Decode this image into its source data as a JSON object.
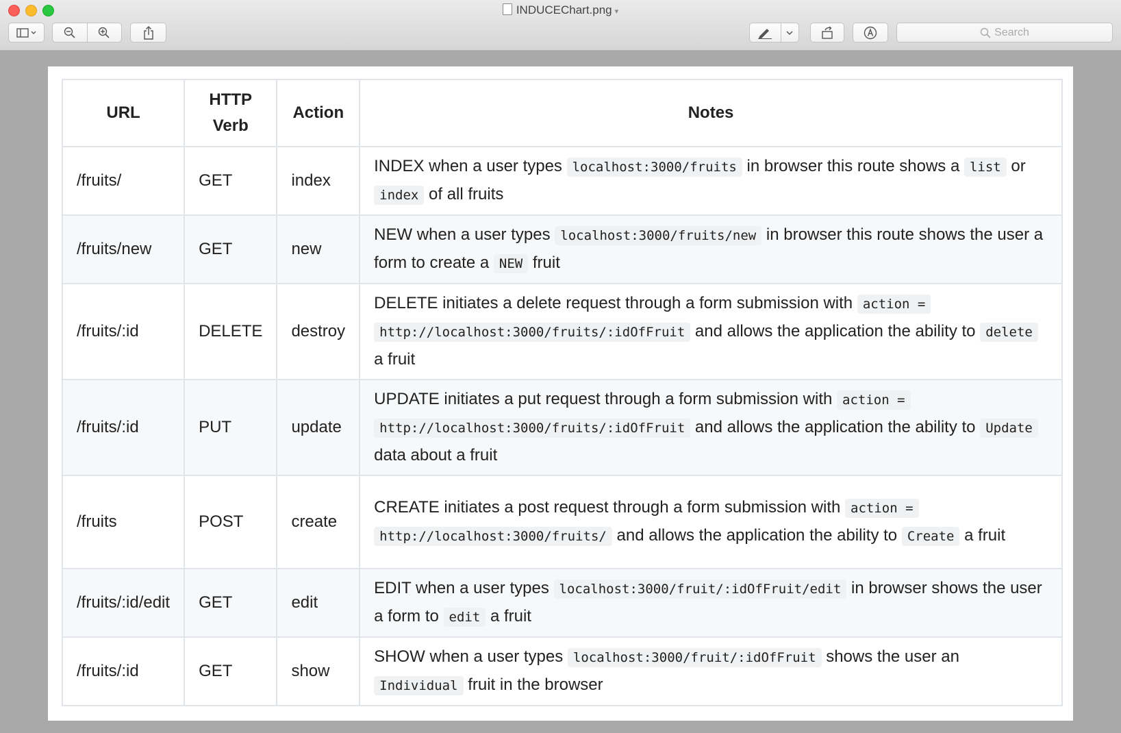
{
  "window": {
    "title": "INDUCEChart.png"
  },
  "toolbar": {
    "search_placeholder": "Search"
  },
  "table": {
    "headers": {
      "url": "URL",
      "verb_line1": "HTTP",
      "verb_line2": "Verb",
      "action": "Action",
      "notes": "Notes"
    },
    "rows": [
      {
        "url": "/fruits/",
        "verb": "GET",
        "action": "index",
        "n": [
          "INDEX when a user types ",
          "localhost:3000/fruits",
          " in browser this route shows a ",
          "list",
          " or ",
          "index",
          " of all fruits"
        ]
      },
      {
        "url": "/fruits/new",
        "verb": "GET",
        "action": "new",
        "n": [
          "NEW when a user types ",
          "localhost:3000/fruits/new",
          " in browser this route shows the user a form to create a ",
          "NEW",
          " fruit"
        ]
      },
      {
        "url": "/fruits/:id",
        "verb": "DELETE",
        "action": "destroy",
        "n": [
          "DELETE initiates a delete request through a form submission with ",
          "action =",
          " ",
          "http://localhost:3000/fruits/:idOfFruit",
          " and allows the application the ability to ",
          "delete",
          " a fruit"
        ]
      },
      {
        "url": "/fruits/:id",
        "verb": "PUT",
        "action": "update",
        "n": [
          "UPDATE initiates a put request through a form submission with ",
          "action =",
          " ",
          "http://localhost:3000/fruits/:idOfFruit",
          " and allows the application the ability to ",
          "Update",
          " data about a fruit"
        ]
      },
      {
        "url": "/fruits",
        "verb": "POST",
        "action": "create",
        "n": [
          "CREATE initiates a post request through a form submission with ",
          "action =",
          " ",
          "http://localhost:3000/fruits/",
          " and allows the application the ability to ",
          "Create",
          " a fruit"
        ]
      },
      {
        "url": "/fruits/:id/edit",
        "verb": "GET",
        "action": "edit",
        "n": [
          "EDIT when a user types ",
          "localhost:3000/fruit/:idOfFruit/edit",
          " in browser shows the user a form to ",
          "edit",
          " a fruit"
        ]
      },
      {
        "url": "/fruits/:id",
        "verb": "GET",
        "action": "show",
        "n": [
          "SHOW when a user types ",
          "localhost:3000/fruit/:idOfFruit",
          " shows the user an ",
          "Individual",
          " fruit in the browser"
        ]
      }
    ]
  }
}
